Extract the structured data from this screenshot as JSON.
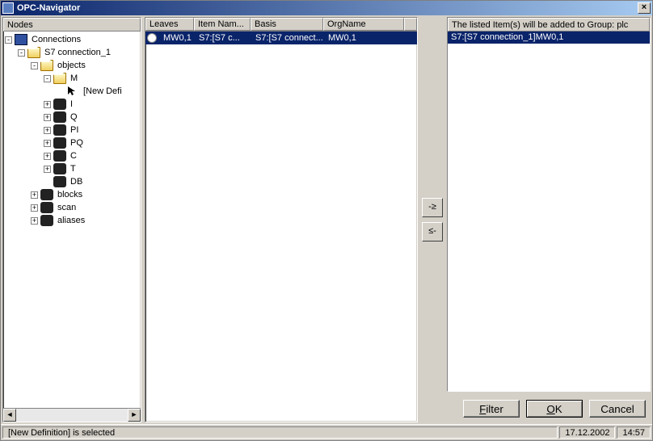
{
  "window": {
    "title": "OPC-Navigator"
  },
  "tree": {
    "header": "Nodes",
    "root": "Connections",
    "conn": "S7 connection_1",
    "objects": "objects",
    "m": "M",
    "newdef": "[New Defi",
    "items": [
      "I",
      "Q",
      "PI",
      "PQ",
      "C",
      "T",
      "DB"
    ],
    "extras": [
      "blocks",
      "scan",
      "aliases"
    ]
  },
  "grid": {
    "headers": [
      "Leaves",
      "Item Nam...",
      "Basis",
      "OrgName"
    ],
    "row": {
      "leaves": "MW0,1",
      "itemname": "S7:[S7 c...",
      "basis": "S7:[S7 connect...",
      "orgname": "MW0,1"
    }
  },
  "move": {
    "right": "-≥",
    "left": "≤-"
  },
  "right": {
    "header_prefix": "The listed Item(s) will be added to Group: ",
    "group": "plc",
    "item": "S7:[S7 connection_1]MW0,1"
  },
  "buttons": {
    "filter": "Filter",
    "ok": "OK",
    "cancel": "Cancel"
  },
  "status": {
    "msg": "[New Definition] is selected",
    "date": "17.12.2002",
    "time": "14:57"
  }
}
